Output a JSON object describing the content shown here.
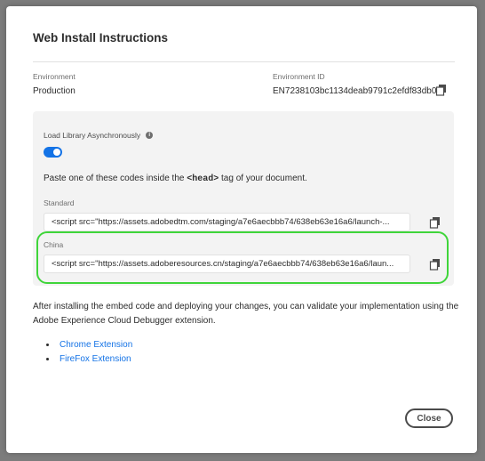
{
  "dialog": {
    "title": "Web Install Instructions"
  },
  "environment": {
    "label": "Environment",
    "value": "Production"
  },
  "environment_id": {
    "label": "Environment ID",
    "value": "EN7238103bc1134deab9791c2efdf83db0",
    "copy_icon": "copy-icon"
  },
  "panel": {
    "toggle_label": "Load Library Asynchronously",
    "toggle_state": "on",
    "info_icon": "info-icon",
    "paste_prefix": "Paste one of these codes inside the ",
    "paste_tag": "<head>",
    "paste_suffix": " tag of your document.",
    "standard": {
      "label": "Standard",
      "code": "<script src=\"https://assets.adobedtm.com/staging/a7e6aecbbb74/638eb63e16a6/launch-..."
    },
    "china": {
      "label": "China",
      "code": "<script src=\"https://assets.adoberesources.cn/staging/a7e6aecbbb74/638eb63e16a6/laun..."
    }
  },
  "instructions": "After installing the embed code and deploying your changes, you can validate your implementation using the Adobe Experience Cloud Debugger extension.",
  "links": [
    {
      "label": "Chrome Extension"
    },
    {
      "label": "FireFox Extension"
    }
  ],
  "colors": {
    "accent": "#1473e6",
    "highlight": "#3fd53a"
  },
  "close_label": "Close"
}
